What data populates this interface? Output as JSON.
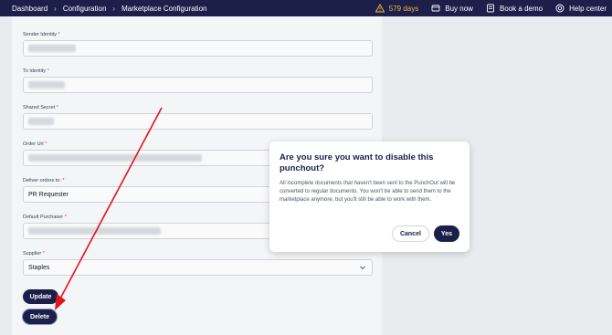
{
  "topbar": {
    "breadcrumbs": [
      "Dashboard",
      "Configuration",
      "Marketplace Configuration"
    ],
    "trial_days": "579 days",
    "buy_now": "Buy now",
    "book_demo": "Book a demo",
    "help_center": "Help center"
  },
  "form": {
    "sender_identity_label": "Sender Identity",
    "to_identity_label": "To Identity",
    "shared_secret_label": "Shared Secret",
    "order_url_label": "Order Url",
    "deliver_orders_label": "Deliver orders to:",
    "deliver_orders_value": "PR Requester",
    "default_purchaser_label": "Default Purchaser",
    "supplier_label": "Supplier",
    "supplier_value": "Staples",
    "required_mark": "*",
    "update_button": "Update",
    "delete_button": "Delete"
  },
  "modal": {
    "title": "Are you sure you want to disable this punchout?",
    "body": "All incomplete documents that haven't been sent to the PunchOut will be converted to regular documents. You won't be able to send them to the marketplace anymore, but you'll still be able to work with them.",
    "cancel_label": "Cancel",
    "yes_label": "Yes"
  },
  "colors": {
    "navy": "#1b1f4a",
    "trial_accent": "#f4b740",
    "annotation_arrow": "#e0141e"
  }
}
